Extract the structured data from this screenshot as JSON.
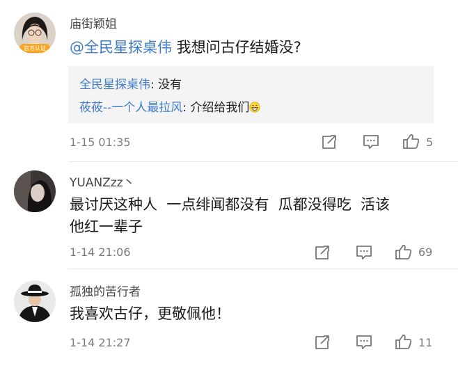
{
  "comments": [
    {
      "username": "庙街颖姐",
      "badge": "官方认证",
      "mention": "@全民星探桌伟",
      "text": " 我想问古仔结婚没?",
      "replies": [
        {
          "name": "全民星探桌伟",
          "text": ": 没有"
        },
        {
          "name": "莜莜--一个人最拉风",
          "text": ": 介绍给我们"
        }
      ],
      "time": "1-15 01:35",
      "likes": "5",
      "share_icon": "share-icon",
      "reply_icon": "comment-icon",
      "like_icon": "thumbs-up-icon"
    },
    {
      "username": "YUANZzz丶",
      "text_line1": "最讨厌这种人  一点绯闻都没有  瓜都没得吃  活该",
      "text_line2": "他红一辈子",
      "time": "1-14 21:06",
      "likes": "69",
      "share_icon": "share-icon",
      "reply_icon": "comment-icon",
      "like_icon": "thumbs-up-icon"
    },
    {
      "username": "孤独的苦行者",
      "text": "我喜欢古仔，更敬佩他！",
      "time": "1-14 21:27",
      "likes": "11",
      "share_icon": "share-icon",
      "reply_icon": "comment-icon",
      "like_icon": "thumbs-up-icon"
    }
  ],
  "colors": {
    "link": "#3e7bc9",
    "meta": "#7a7a7a",
    "reply_bg": "#f4f4f4",
    "badge": "#f5a623"
  }
}
